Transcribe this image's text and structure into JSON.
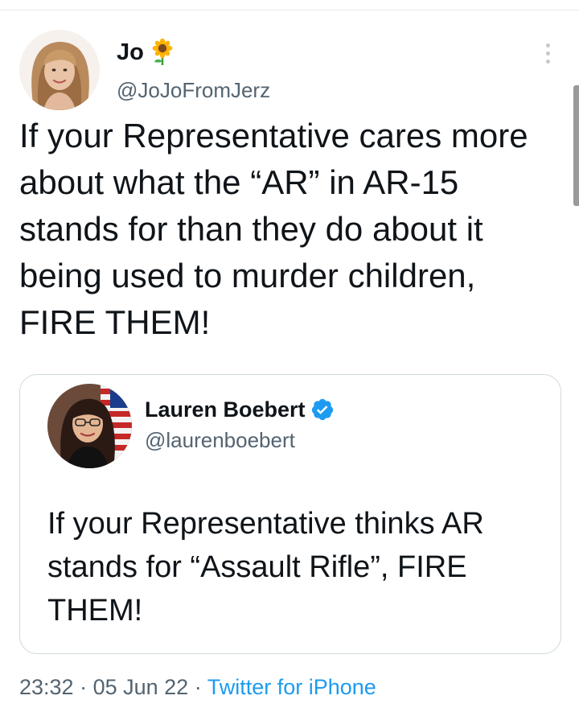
{
  "tweet": {
    "author_name": "Jo",
    "author_handle": "@JoJoFromJerz",
    "text_lines": [
      "If your Representative cares more",
      "about what the “AR” in AR-15",
      "stands for than they do about it",
      "being used to murder children,",
      "FIRE THEM!"
    ],
    "time": "23:32",
    "date": "05 Jun 22",
    "source": "Twitter for iPhone",
    "separator": " · "
  },
  "quoted_tweet": {
    "author_name": "Lauren Boebert",
    "author_handle": "@laurenboebert",
    "text_lines": [
      "If your Representative thinks AR",
      "stands for “Assault Rifle”, FIRE",
      "THEM!"
    ]
  },
  "icons": {
    "name_emoji": "sunflower-icon",
    "verified": "verified-badge-icon",
    "more": "more-options-icon"
  },
  "colors": {
    "text": "#0f1419",
    "secondary_text": "#536471",
    "link": "#1d9bf0",
    "verified": "#1d9bf0",
    "border": "#cfd9de"
  }
}
